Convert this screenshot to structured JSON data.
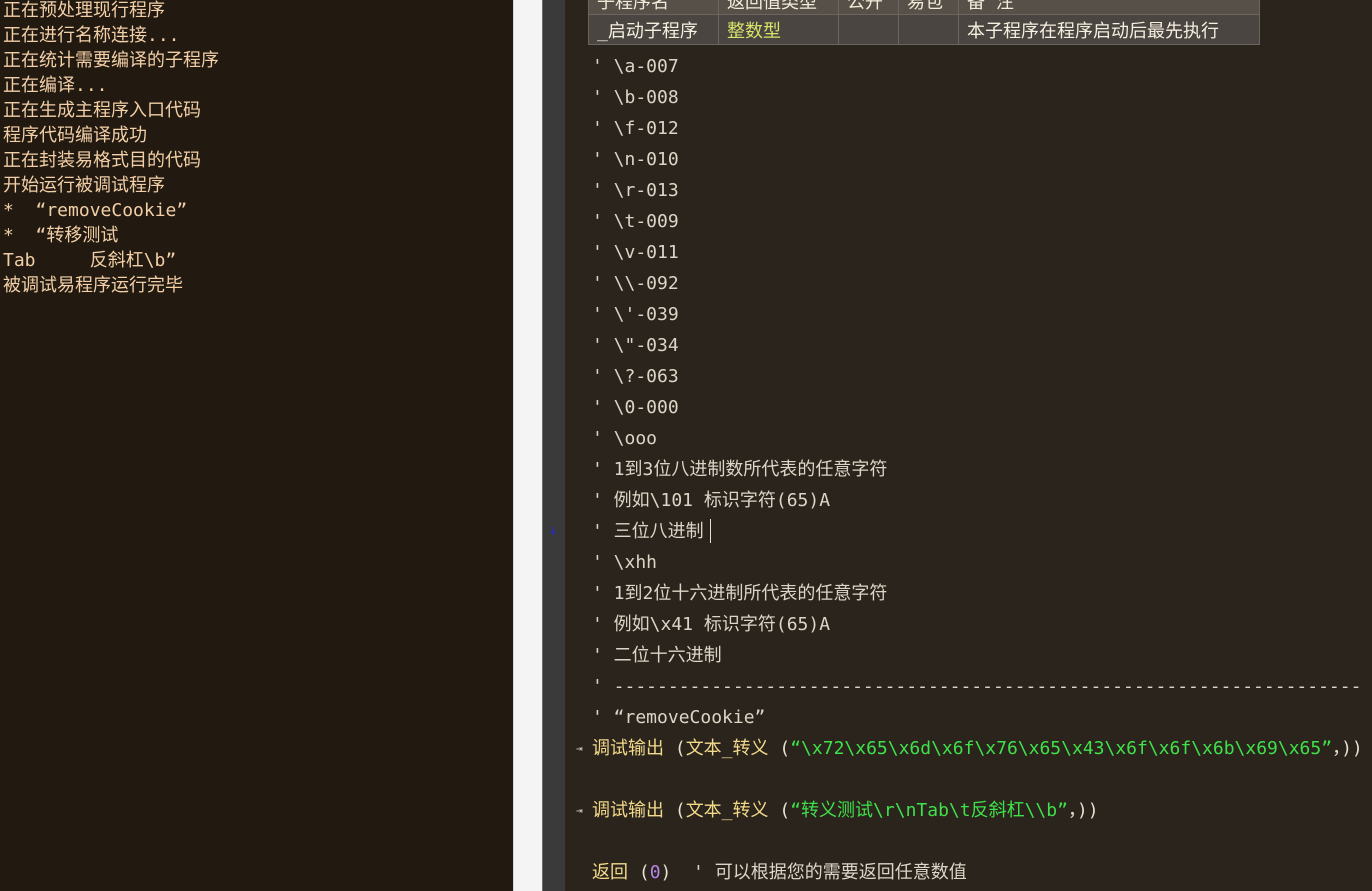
{
  "output": {
    "lines": [
      "正在预处理现行程序",
      "正在进行名称连接...",
      "正在统计需要编译的子程序",
      "正在编译...",
      "正在生成主程序入口代码",
      "程序代码编译成功",
      "正在封装易格式目的代码",
      "开始运行被调试程序",
      "*  “removeCookie”",
      "*  “转移测试",
      "Tab     反斜杠\\b”",
      "被调试易程序运行完毕"
    ]
  },
  "table": {
    "headers": [
      "子程序名",
      "返回值类型",
      "公开",
      "易包",
      "备 注"
    ],
    "row": {
      "name": "_启动子程序",
      "type": "整数型",
      "public": "",
      "package": "",
      "remark": "本子程序在程序启动后最先执行"
    }
  },
  "comments": [
    "' \\a-007",
    "' \\b-008",
    "' \\f-012",
    "' \\n-010",
    "' \\r-013",
    "' \\t-009",
    "' \\v-011",
    "' \\\\-092",
    "' \\'-039",
    "' \\\"-034",
    "' \\?-063",
    "' \\0-000",
    "' \\ooo",
    "' 1到3位八进制数所代表的任意字符",
    "' 例如\\101 标识字符(65)A",
    "' 三位八进制",
    "' \\xhh",
    "' 1到2位十六进制所代表的任意字符",
    "' 例如\\x41 标识字符(65)A",
    "' 二位十六进制",
    "' ---------------------------------------------------------------------",
    "' “removeCookie”"
  ],
  "code": {
    "line1": {
      "func": "调试输出",
      "open1": " (",
      "func2": "文本_转义",
      "open2": " (",
      "string": "“\\x72\\x65\\x6d\\x6f\\x76\\x65\\x43\\x6f\\x6f\\x6b\\x69\\x65”",
      "close": "，))"
    },
    "line2": {
      "func": "调试输出",
      "open1": " (",
      "func2": "文本_转义",
      "open2": " (",
      "string": "“转义测试\\r\\nTab\\t反斜杠\\\\b”",
      "close": "，))"
    },
    "line3": {
      "kw": "返回",
      "open": " (",
      "num": "0",
      "close": ")",
      "comment": "  ' 可以根据您的需要返回任意数值"
    }
  },
  "icons": {
    "debug_arrow": "down-arrow-icon",
    "flow_marker": "flow-marker-icon"
  },
  "colors": {
    "output_text": "#f2cfa6",
    "string": "#3fe14a",
    "number": "#b486e8",
    "keyword": "#f3d98a",
    "type": "#d8e36a",
    "debug_arrow": "#1e2ce6"
  }
}
